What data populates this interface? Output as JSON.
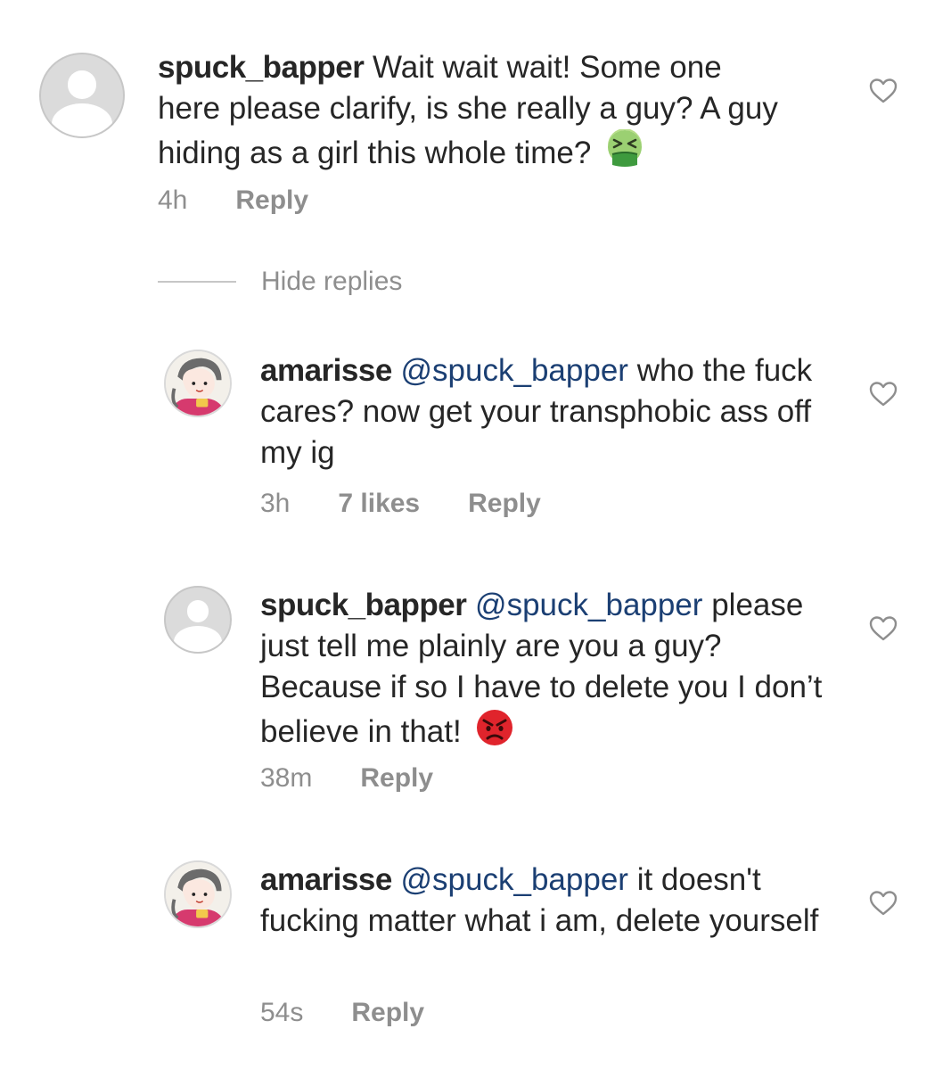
{
  "comments": [
    {
      "username": "spuck_bapper",
      "mention": "",
      "text": "Wait wait wait! Some one here please clarify, is she really a guy?  A guy hiding as a girl this whole time?",
      "emoji": "nauseated-face-emoji",
      "time": "4h",
      "likes": "",
      "reply": "Reply",
      "avatar": "default-avatar"
    },
    {
      "username": "amarisse",
      "mention": "@spuck_bapper",
      "text": "who the fuck cares? now get your transphobic ass off my ig",
      "emoji": "",
      "time": "3h",
      "likes": "7 likes",
      "reply": "Reply",
      "avatar": "illustrated-avatar"
    },
    {
      "username": "spuck_bapper",
      "mention": "@spuck_bapper",
      "text": "please just tell me plainly are you a guy?  Because if so I have to delete you I don’t believe in that!",
      "emoji": "angry-face-emoji",
      "time": "38m",
      "likes": "",
      "reply": "Reply",
      "avatar": "default-avatar"
    },
    {
      "username": "amarisse",
      "mention": "@spuck_bapper",
      "text": "it doesn't fucking matter what i am, delete yourself",
      "emoji": "",
      "time": "54s",
      "likes": "",
      "reply": "Reply",
      "avatar": "illustrated-avatar"
    }
  ],
  "hide_replies": "Hide replies",
  "colors": {
    "text": "#262626",
    "mention": "#1b3f73",
    "meta": "#8e8e8e",
    "divider": "#c7c7c7"
  }
}
